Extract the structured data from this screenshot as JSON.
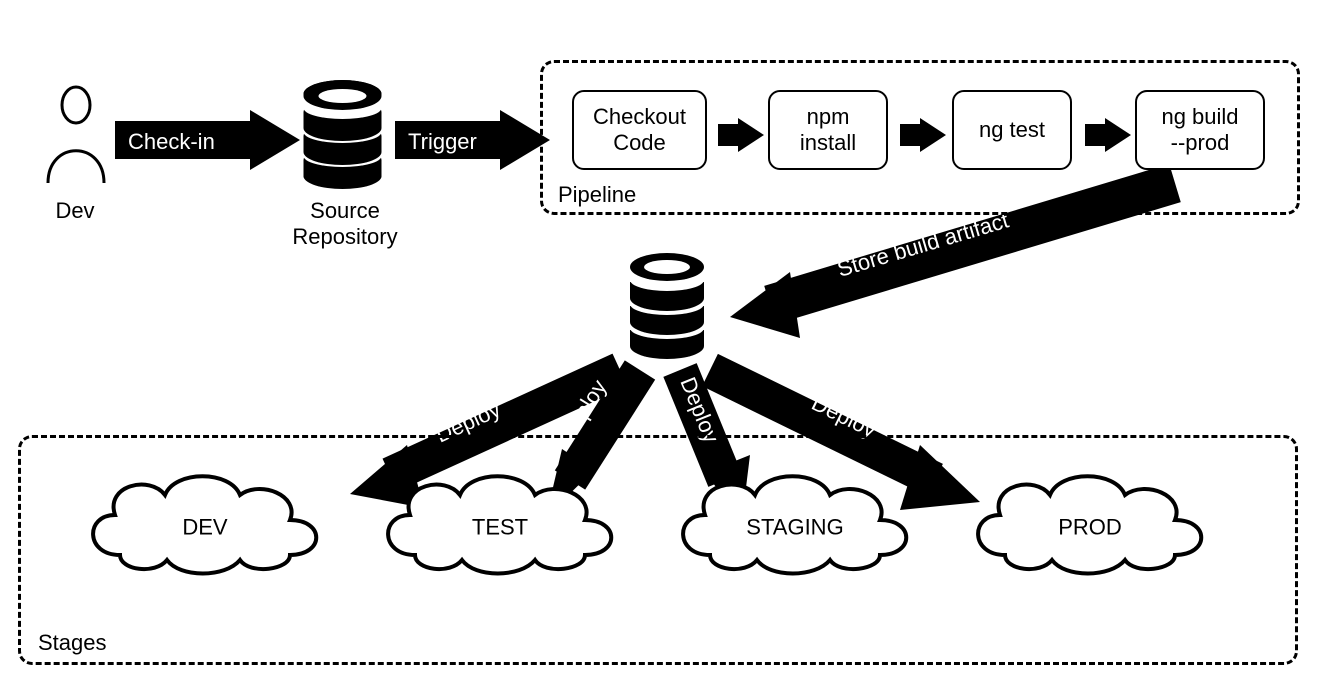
{
  "actors": {
    "dev": "Dev",
    "source_repo_line1": "Source",
    "source_repo_line2": "Repository"
  },
  "arrows": {
    "checkin": "Check-in",
    "trigger": "Trigger",
    "store_artifact": "Store build artifact",
    "deploy": "Deploy"
  },
  "pipeline": {
    "caption": "Pipeline",
    "steps": {
      "s1_l1": "Checkout",
      "s1_l2": "Code",
      "s2_l1": "npm",
      "s2_l2": "install",
      "s3": "ng test",
      "s4_l1": "ng build",
      "s4_l2": "--prod"
    }
  },
  "stages": {
    "caption": "Stages",
    "envs": {
      "dev": "DEV",
      "test": "TEST",
      "staging": "STAGING",
      "prod": "PROD"
    }
  }
}
